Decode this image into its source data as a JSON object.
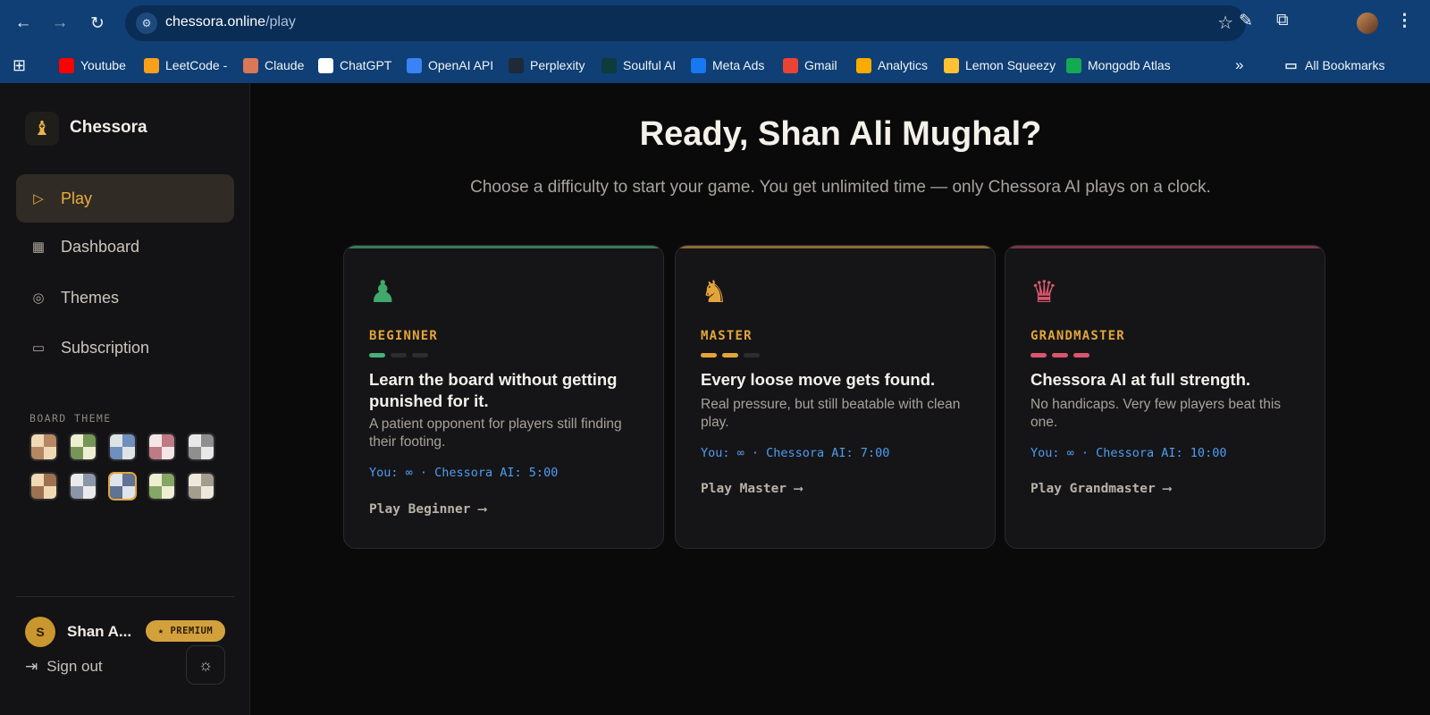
{
  "browser": {
    "url_domain": "chessora.online",
    "url_path": "/play",
    "bookmarks": [
      {
        "label": "Youtube",
        "icon": "youtube-icon",
        "color": "#ff0000"
      },
      {
        "label": "LeetCode -",
        "icon": "leetcode-icon",
        "color": "#f89f1b"
      },
      {
        "label": "Claude",
        "icon": "claude-icon",
        "color": "#d97757"
      },
      {
        "label": "ChatGPT",
        "icon": "chatgpt-icon",
        "color": "#ffffff"
      },
      {
        "label": "OpenAI API",
        "icon": "openai-icon",
        "color": "#3b82f6"
      },
      {
        "label": "Perplexity",
        "icon": "perplexity-icon",
        "color": "#1f2937"
      },
      {
        "label": "Soulful AI",
        "icon": "soulful-icon",
        "color": "#0e3b3b"
      },
      {
        "label": "Meta Ads",
        "icon": "meta-icon",
        "color": "#1877f2"
      },
      {
        "label": "Gmail",
        "icon": "gmail-icon",
        "color": "#ea4335"
      },
      {
        "label": "Analytics",
        "icon": "analytics-icon",
        "color": "#f9ab00"
      },
      {
        "label": "Lemon Squeezy",
        "icon": "lemon-icon",
        "color": "#ffc233"
      },
      {
        "label": "Mongodb Atlas",
        "icon": "mongodb-icon",
        "color": "#13aa52"
      }
    ],
    "all_bookmarks_label": "All Bookmarks"
  },
  "sidebar": {
    "brand": "Chessora",
    "nav": [
      {
        "label": "Play",
        "icon": "play-icon",
        "active": true
      },
      {
        "label": "Dashboard",
        "icon": "dashboard-icon",
        "active": false
      },
      {
        "label": "Themes",
        "icon": "palette-icon",
        "active": false
      },
      {
        "label": "Subscription",
        "icon": "card-icon",
        "active": false
      }
    ],
    "board_theme_label": "BOARD THEME",
    "themes": [
      {
        "light": "#f0d9b5",
        "dark": "#b58863"
      },
      {
        "light": "#eeeed2",
        "dark": "#769656"
      },
      {
        "light": "#dee3e6",
        "dark": "#6f8fbf"
      },
      {
        "light": "#f4e6e6",
        "dark": "#c07a86"
      },
      {
        "light": "#e8e8e8",
        "dark": "#8f8f8f"
      },
      {
        "light": "#f0d9b5",
        "dark": "#9e7250"
      },
      {
        "light": "#eaeaea",
        "dark": "#8b97a8"
      },
      {
        "light": "#dfe3ec",
        "dark": "#5f7394",
        "selected": true
      },
      {
        "light": "#eeeed2",
        "dark": "#86a666"
      },
      {
        "light": "#ece8dc",
        "dark": "#a39d8e"
      }
    ],
    "user": {
      "initial": "S",
      "name": "Shan A...",
      "badge": "★ PREMIUM"
    },
    "signout_label": "Sign out"
  },
  "main": {
    "headline": "Ready, Shan Ali Mughal?",
    "subline": "Choose a difficulty to start your game. You get unlimited time — only Chessora AI plays on a clock.",
    "cards": [
      {
        "icon": "♟",
        "icon_name": "pawn-icon",
        "icon_color": "#3fa86a",
        "level": "BEGINNER",
        "accent": "#3b7a5a",
        "bar_color": "#46b278",
        "filled_bars": 1,
        "title": "Learn the board without getting punished for it.",
        "desc": "A patient opponent for players still finding their footing.",
        "clock": "You: ∞ · Chessora AI: 5:00",
        "cta": "Play Beginner ⟶"
      },
      {
        "icon": "♞",
        "icon_name": "knight-icon",
        "icon_color": "#e3a53b",
        "level": "MASTER",
        "accent": "#8a6a34",
        "bar_color": "#e3a53b",
        "filled_bars": 2,
        "title": "Every loose move gets found.",
        "desc": "Real pressure, but still beatable with clean play.",
        "clock": "You: ∞ · Chessora AI: 7:00",
        "cta": "Play Master ⟶"
      },
      {
        "icon": "♛",
        "icon_name": "queen-icon",
        "icon_color": "#d9566e",
        "level": "GRANDMASTER",
        "accent": "#7a3546",
        "bar_color": "#d9566e",
        "filled_bars": 3,
        "title": "Chessora AI at full strength.",
        "desc": "No handicaps. Very few players beat this one.",
        "clock": "You: ∞ · Chessora AI: 10:00",
        "cta": "Play Grandmaster ⟶"
      }
    ]
  }
}
